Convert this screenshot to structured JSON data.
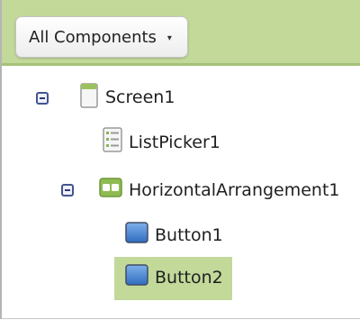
{
  "toolbar": {
    "filter_dropdown_label": "All Components",
    "filter_caret": "▾"
  },
  "tree": {
    "screen": {
      "label": "Screen1",
      "icon": "screen-icon"
    },
    "listpicker": {
      "label": "ListPicker1",
      "icon": "list-picker-icon"
    },
    "arrangement": {
      "label": "HorizontalArrangement1",
      "icon": "horizontal-arrangement-icon"
    },
    "button1": {
      "label": "Button1",
      "icon": "button-icon"
    },
    "button2": {
      "label": "Button2",
      "icon": "button-icon",
      "selected": true
    }
  },
  "colors": {
    "header_bg": "#c2d99a",
    "selection_bg": "#c2d99a",
    "toggle_border": "#44548f"
  }
}
